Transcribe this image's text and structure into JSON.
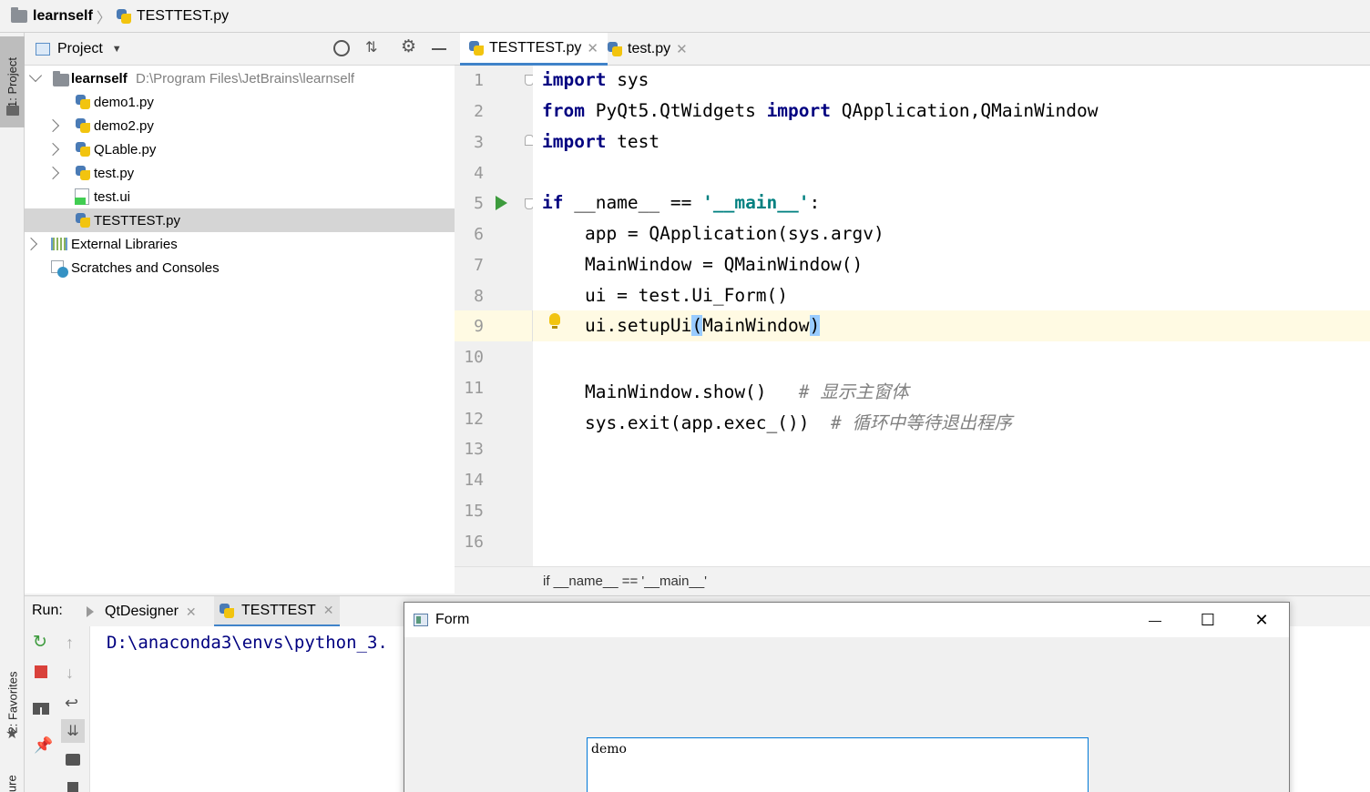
{
  "breadcrumb": {
    "project": "learnself",
    "file": "TESTTEST.py"
  },
  "left_stripe": {
    "project_tab": "1: Project",
    "favorites_tab": "2: Favorites",
    "structure_tab": "ture"
  },
  "project_panel": {
    "title": "Project",
    "tree": [
      {
        "label": "learnself",
        "path": "D:\\Program Files\\JetBrains\\learnself",
        "type": "folder",
        "expanded": true
      },
      {
        "label": "demo1.py",
        "type": "py"
      },
      {
        "label": "demo2.py",
        "type": "py",
        "expandable": true
      },
      {
        "label": "QLable.py",
        "type": "py",
        "expandable": true
      },
      {
        "label": "test.py",
        "type": "py",
        "expandable": true
      },
      {
        "label": "test.ui",
        "type": "ui"
      },
      {
        "label": "TESTTEST.py",
        "type": "py",
        "selected": true
      },
      {
        "label": "External Libraries",
        "type": "lib",
        "expandable": true
      },
      {
        "label": "Scratches and Consoles",
        "type": "scratch"
      }
    ]
  },
  "editor": {
    "tabs": [
      {
        "label": "TESTTEST.py",
        "active": true
      },
      {
        "label": "test.py",
        "active": false
      }
    ],
    "line_numbers": [
      "1",
      "2",
      "3",
      "4",
      "5",
      "6",
      "7",
      "8",
      "9",
      "10",
      "11",
      "12",
      "13",
      "14",
      "15",
      "16"
    ],
    "code": {
      "l1_kw": "import",
      "l1_rest": " sys",
      "l2_kw1": "from",
      "l2_mid": " PyQt5.QtWidgets ",
      "l2_kw2": "import",
      "l2_rest": " QApplication,QMainWindow",
      "l3_kw": "import",
      "l3_rest": " test",
      "l5_kw": "if",
      "l5_mid": " __name__ == ",
      "l5_str": "'__main__'",
      "l5_end": ":",
      "l6": "    app = QApplication(sys.argv)",
      "l7": "    MainWindow = QMainWindow()",
      "l8": "    ui = test.Ui_Form()",
      "l9_a": "    ui.setupUi",
      "l9_p1": "(",
      "l9_b": "MainWindow",
      "l9_p2": ")",
      "l11_code": "    MainWindow.show()   ",
      "l11_cm": "# 显示主窗体",
      "l12_code": "    sys.exit(app.exec_())  ",
      "l12_cm": "# 循环中等待退出程序"
    },
    "status_crumb": "if __name__ == '__main__'"
  },
  "run_panel": {
    "label": "Run:",
    "tabs": [
      {
        "label": "QtDesigner"
      },
      {
        "label": "TESTTEST",
        "active": true
      }
    ],
    "console_text": "D:\\anaconda3\\envs\\python_3."
  },
  "form_window": {
    "title": "Form",
    "minimize": "—",
    "maximize": "☐",
    "close": "✕",
    "label_text": "demo"
  }
}
